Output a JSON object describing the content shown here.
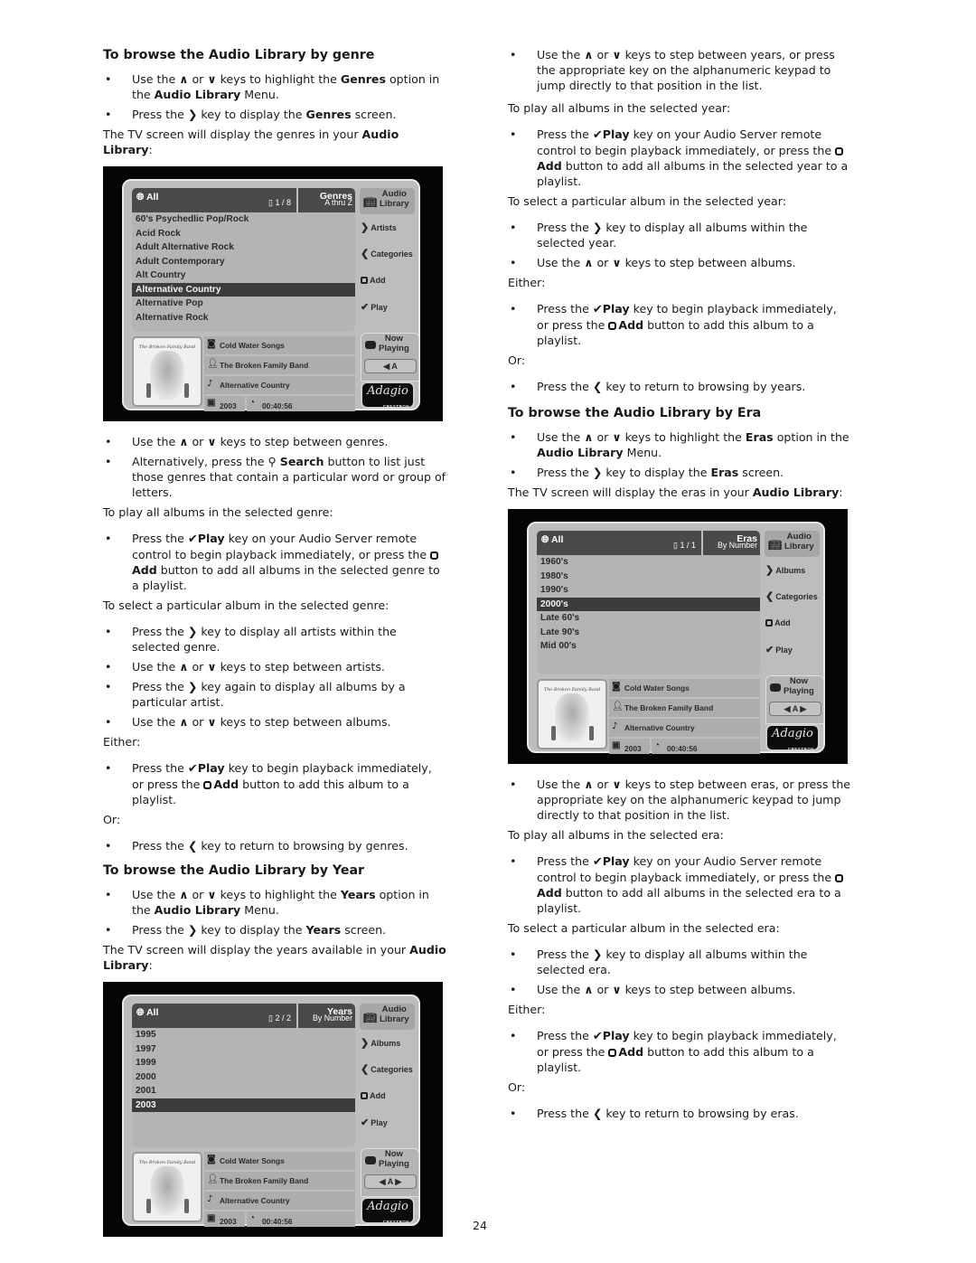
{
  "page_number": "24",
  "icons": {
    "up": "∧",
    "down": "∨",
    "right": "❯",
    "left": "❮",
    "check": "✔",
    "search": "🔍︎"
  },
  "genre": {
    "heading": "To browse the Audio Library by genre",
    "intro_bullets": [
      {
        "pre": "Use the ",
        "mid": " or ",
        "post": " keys to highlight the ",
        "b1": "Genres",
        "post2": " option in the ",
        "b2": "Audio Library",
        "post3": " Menu."
      },
      {
        "pre": "Press the ",
        "post": " key to display the ",
        "b1": "Genres",
        "post2": " screen."
      }
    ],
    "tv_intro_pre": "The TV screen will display the genres in your ",
    "tv_intro_b": "Audio Library",
    "tv_intro_post": ":",
    "screen": {
      "all_label": "All",
      "page": "1 / 8",
      "title": "Genres",
      "sort": "A thru Z",
      "library_label_1": "Audio",
      "library_label_2": "Library",
      "nav_right": "Artists",
      "nav_left": "Categories",
      "add": "Add",
      "play": "Play",
      "items": [
        "60's Psychedlic Pop/Rock",
        "Acid Rock",
        "Adult Alternative Rock",
        "Adult Contemporary",
        "Alt Country",
        "Alternative Country",
        "Alternative Pop",
        "Alternative Rock"
      ],
      "selected_index": 5,
      "album": "Cold Water Songs",
      "artist": "The Broken Family Band",
      "genre": "Alternative Country",
      "year": "2003",
      "duration": "00:40:56",
      "now_playing_1": "Now",
      "now_playing_2": "Playing",
      "source": "A",
      "logo": "Adagio",
      "logo_sub": "CRESTRON",
      "art_caption": "The Broken Family Band"
    },
    "step_bullets": [
      "keys to step between genres.",
      "Alternatively, press the",
      "Search",
      "button to list just those genres that contain a particular word or group of letters."
    ],
    "play_all_label": "To play all albums in the selected genre:",
    "play_all_text": {
      "pre": "Press the ",
      "play": "Play",
      "mid": " key on your Audio Server remote control to begin playback immediately, or press the ",
      "add": "Add",
      "post": " button to add all albums in the selected genre to a playlist."
    },
    "select_label": "To select a particular album in the selected genre:",
    "select_bullets": [
      {
        "kind": "right",
        "text": " key to display all artists within the selected genre."
      },
      {
        "kind": "updown",
        "text": " keys to step between artists."
      },
      {
        "kind": "right",
        "text": " key again to display all albums by a particular artist."
      },
      {
        "kind": "updown",
        "text": " keys to step between albums."
      }
    ],
    "either": "Either:",
    "either_text": {
      "pre": "Press the ",
      "play": "Play",
      "mid": " key to begin playback immediately, or press the ",
      "add": "Add",
      "post": " button to add this album to a playlist."
    },
    "or": "Or:",
    "return_text": " key to return to browsing by genres."
  },
  "year": {
    "heading": "To browse the Audio Library by Year",
    "b1": "Years",
    "tv_intro_pre": "The TV screen will display the years available in your ",
    "tv_intro_b": "Audio Library",
    "screen": {
      "all_label": "All",
      "page": "2 / 2",
      "title": "Years",
      "sort": "By Number",
      "nav_right": "Albums",
      "nav_left": "Categories",
      "add": "Add",
      "play": "Play",
      "items": [
        "1995",
        "1997",
        "1999",
        "2000",
        "2001",
        "2003"
      ],
      "selected_index": 5,
      "source": "A"
    },
    "step_text": " keys to step between years, or press the appropriate key on the alphanumeric keypad to jump directly to that position in the list.",
    "play_all_label": "To play all albums in the selected year:",
    "play_all_post": " button to add all albums in the selected year to a playlist.",
    "select_label": "To select a particular album in the selected year:",
    "select_right": " key to display all albums within the selected year.",
    "select_updown": " keys to step between albums.",
    "return_text": " key to return to browsing by years."
  },
  "era": {
    "heading": "To browse the Audio Library by Era",
    "b1": "Eras",
    "tv_intro_pre": "The TV screen will display the eras in your ",
    "tv_intro_b": "Audio Library",
    "screen": {
      "all_label": "All",
      "page": "1 / 1",
      "title": "Eras",
      "sort": "By Number",
      "nav_right": "Albums",
      "nav_left": "Categories",
      "add": "Add",
      "play": "Play",
      "items": [
        "1960's",
        "1980's",
        "1990's",
        "2000's",
        "Late 60's",
        "Late 90's",
        "Mid 00's"
      ],
      "selected_index": 3,
      "source": "A"
    },
    "step_text": " keys to step between eras, or press the appropriate key on the alphanumeric keypad to jump directly to that position in the list.",
    "play_all_label": "To play all albums in the selected era:",
    "play_all_post": " button to add all albums in the selected era to a playlist.",
    "select_label": "To select a particular album in the selected era:",
    "select_right": " key to display all albums within the selected era.",
    "select_updown": " keys to step between albums.",
    "return_text": " key to return to browsing by eras."
  },
  "common": {
    "use_the": "Use the ",
    "or": " or ",
    "press_the": "Press the ",
    "keys_highlight": " keys to highlight the ",
    "option_in_the": " option in the ",
    "audio_library": "Audio Library",
    "menu": " Menu.",
    "key_display_the": " key to display the ",
    "screen": " screen.",
    "play": "Play",
    "add": "Add",
    "play_all_mid": " key on your Audio Server remote control to begin playback immediately, or press the ",
    "either": "Either:",
    "or_label": "Or:",
    "either_mid": " key to begin playback immediately, or press the ",
    "either_post": " button to add this album to a playlist.",
    "colon": ":"
  }
}
